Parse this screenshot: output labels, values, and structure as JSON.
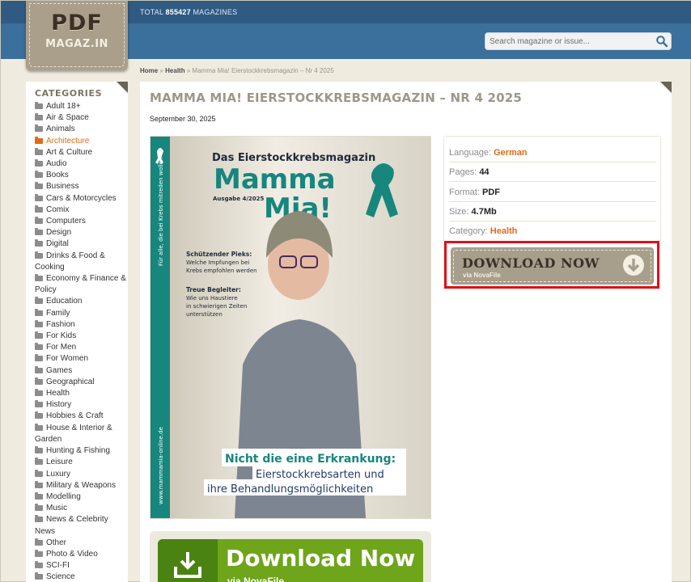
{
  "header": {
    "total_prefix": "TOTAL",
    "total_count": "855427",
    "total_suffix": "MAGAZINES",
    "search_placeholder": "Search magazine or issue..."
  },
  "logo": {
    "line1": "PDF",
    "line2": "MAGAZ.IN"
  },
  "breadcrumb": {
    "home": "Home",
    "sep": "»",
    "section": "Health",
    "current": "Mamma Mia! Eierstockkrebsmagazin – Nr 4 2025"
  },
  "sidebar": {
    "title": "CATEGORIES",
    "items": [
      {
        "label": "Adult 18+"
      },
      {
        "label": "Air & Space"
      },
      {
        "label": "Animals"
      },
      {
        "label": "Architecture",
        "active": true
      },
      {
        "label": "Art & Culture"
      },
      {
        "label": "Audio"
      },
      {
        "label": "Books"
      },
      {
        "label": "Business"
      },
      {
        "label": "Cars & Motorcycles"
      },
      {
        "label": "Comix"
      },
      {
        "label": "Computers"
      },
      {
        "label": "Design"
      },
      {
        "label": "Digital"
      },
      {
        "label": "Drinks & Food & Cooking"
      },
      {
        "label": "Economy & Finance & Policy"
      },
      {
        "label": "Education"
      },
      {
        "label": "Family"
      },
      {
        "label": "Fashion"
      },
      {
        "label": "For Kids"
      },
      {
        "label": "For Men"
      },
      {
        "label": "For Women"
      },
      {
        "label": "Games"
      },
      {
        "label": "Geographical"
      },
      {
        "label": "Health"
      },
      {
        "label": "History"
      },
      {
        "label": "Hobbies & Craft"
      },
      {
        "label": "House & Interior & Garden"
      },
      {
        "label": "Hunting & Fishing"
      },
      {
        "label": "Leisure"
      },
      {
        "label": "Luxury"
      },
      {
        "label": "Military & Weapons"
      },
      {
        "label": "Modelling"
      },
      {
        "label": "Music"
      },
      {
        "label": "News & Celebrity News"
      },
      {
        "label": "Other"
      },
      {
        "label": "Photo & Video"
      },
      {
        "label": "SCI-FI"
      },
      {
        "label": "Science"
      }
    ]
  },
  "page": {
    "title": "MAMMA MIA! EIERSTOCKKREBSMAGAZIN – NR 4 2025",
    "date": "September 30, 2025"
  },
  "cover": {
    "kicker": "Das Eierstockkrebsmagazin",
    "brand_line1": "Mamma",
    "brand_line2": "Mia!",
    "issue": "Ausgabe 4/2025",
    "side_text": "Für alle, die bei Krebs mitreden wollen",
    "url": "www.mammamia-online.de",
    "teaser1_title": "Schützender Pieks:",
    "teaser1_l1": "Welche Impfungen bei",
    "teaser1_l2": "Krebs empfohlen werden",
    "teaser2_title": "Treue Begleiter:",
    "teaser2_l1": "Wie uns Haustiere",
    "teaser2_l2": "in schwierigen Zeiten",
    "teaser2_l3": "unterstützen",
    "headline1": "Nicht die eine Erkrankung:",
    "headline2": "Eierstockkrebsarten und",
    "headline3": "ihre Behandlungsmöglichkeiten",
    "colors": {
      "teal": "#17867d",
      "navy": "#233a66"
    }
  },
  "info": {
    "language_label": "Language:",
    "language_value": "German",
    "pages_label": "Pages:",
    "pages_value": "44",
    "format_label": "Format:",
    "format_value": "PDF",
    "size_label": "Size:",
    "size_value": "4.7Mb",
    "category_label": "Category:",
    "category_value": "Health"
  },
  "download_now": {
    "label": "DOWNLOAD NOW",
    "sub": "via NovaFile"
  },
  "big_download": {
    "label": "Download Now",
    "sub": "via NovaFile"
  },
  "colors": {
    "accent_orange": "#e06a1a",
    "header_blue": "#3b6f9c",
    "highlight_red": "#e0101b",
    "green": "#6ea51b"
  }
}
